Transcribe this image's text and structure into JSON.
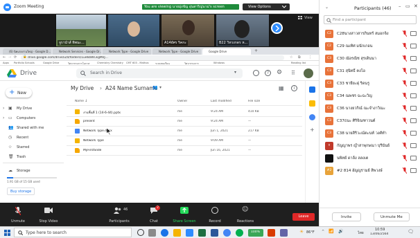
{
  "zoom": {
    "window_title": "Zoom Meeting",
    "view_label": "View",
    "banner_text": "You are viewing นายมุ่งขัญ อุ่นสาริญ่นาม่'s screen",
    "view_options_label": "View Options",
    "tiles": [
      {
        "label": "จูรานำส์ ทิพนะ..."
      },
      {
        "label": ""
      },
      {
        "label": "A14ยัศร ริคกะ"
      },
      {
        "label": "B22 วิทวงกดร ห..."
      }
    ],
    "toolbar": {
      "unmute": "Unmute",
      "stop_video": "Stop Video",
      "participants": "Participants",
      "participants_count": "46",
      "chat": "Chat",
      "chat_badge": "2",
      "share_screen": "Share Screen",
      "record": "Record",
      "reactions": "Reactions",
      "leave": "Leave"
    }
  },
  "browser": {
    "tabs": [
      "(6) นิคแรงงานใหญ่ - Google D...",
      "Network Services - Google Dr...",
      "Network Type - Google Drive",
      "Network Type - Google Drive",
      "Google Drive"
    ],
    "url": "drive.google.com/drive/u/0/folders/1ue6bWCkgMnJ...",
    "bookmarks": [
      "Apps",
      "Portfolio Schools",
      "Google Drive",
      "วิศวกรรมการโอกาส",
      "Chemistry Chemistry",
      "CMT 603 - Mathos",
      "ระบบทบเรียน",
      "วิศวกรรมการ",
      "Windows",
      "Reading list"
    ]
  },
  "drive": {
    "app_name": "Drive",
    "search_placeholder": "Search in Drive",
    "new_label": "New",
    "breadcrumb_root": "My Drive",
    "breadcrumb_folder": "A24 Name Surname",
    "columns": {
      "name": "Name",
      "owner": "Owner",
      "modified": "Last modified",
      "size": "File size"
    },
    "sidebar": [
      {
        "label": "My Drive"
      },
      {
        "label": "Computers"
      },
      {
        "label": "Shared with me"
      },
      {
        "label": "Recent"
      },
      {
        "label": "Starred"
      },
      {
        "label": "Trash"
      }
    ],
    "storage_label": "Storage",
    "storage_used": "1.91 GB of 15 GB used",
    "buy_storage": "Buy storage",
    "files": [
      {
        "name": "งานชิ้นที่ 1 (14-6-44).pptx",
        "owner": "me",
        "modified": "9:24 AM",
        "size": "410 KB",
        "type": "slides"
      },
      {
        "name": "present",
        "owner": "me",
        "modified": "9:24 AM",
        "size": "—",
        "type": "folder"
      },
      {
        "name": "Network Type.docx",
        "owner": "me",
        "modified": "Jun 1, 2021",
        "size": "217 KB",
        "type": "doc"
      },
      {
        "name": "Network Type",
        "owner": "me",
        "modified": "9:09 AM",
        "size": "—",
        "type": "slides"
      },
      {
        "name": "MyFirstSlide",
        "owner": "me",
        "modified": "Jun 16, 2021",
        "size": "—",
        "type": "folder"
      }
    ]
  },
  "participants": {
    "title": "Participants (46)",
    "search_placeholder": "Find a participant",
    "list": [
      {
        "initials": "C2",
        "name": "C28นางสาวสารภินทร์ สมอกจิ่ง",
        "color": "#e8733a"
      },
      {
        "initials": "C2",
        "name": "C29 ณเทิศ มนักเกอน",
        "color": "#e8733a"
      },
      {
        "initials": "C3",
        "name": "C30 ณัอรณิช สุรเดินนา",
        "color": "#e8733a"
      },
      {
        "initials": "C3",
        "name": "C31 สุนิทธิ์ คงโอ",
        "color": "#e8733a"
      },
      {
        "initials": "C3",
        "name": "C33 ชายียะฝุ ริดนรู",
        "color": "#e8733a"
      },
      {
        "initials": "C3",
        "name": "C34 ณพชร ฉะฉะวิญ",
        "color": "#e8733a"
      },
      {
        "initials": "C3",
        "name": "C36 นางยวกิณ์ ณะจำงาวิณะ",
        "color": "#e8733a"
      },
      {
        "initials": "C3",
        "name": "C37ธนะ ศิริจิณฑาวนต์",
        "color": "#e8733a"
      },
      {
        "initials": "C3",
        "name": "C38 นายสิริวะณ์ตะนท์ วงศ์ทำ",
        "color": "#e8733a"
      },
      {
        "initials": "ก",
        "name": "กัญญาพร ญ้ำสาพุกษณา บุรีนันย์",
        "color": "#c0392b"
      },
      {
        "initials": "",
        "name": "นพิทย์ ดาล้ัง ลลงเต",
        "color": "#111111"
      },
      {
        "initials": "#2",
        "name": "#2 814 อัญญรามย์ สิพวงษ์",
        "color": "#e8a33a"
      }
    ],
    "invite": "Invite",
    "unmute_me": "Unmute Me"
  },
  "taskbar": {
    "search_placeholder": "Type here to search",
    "weather": "86°F",
    "time": "10:59",
    "date": "13/06/2564",
    "language": "ไทย",
    "battery": "100%"
  },
  "colors": {
    "drive_blue": "#1a73e8",
    "zoom_blue": "#2d8cff",
    "leave_red": "#e02828",
    "share_green": "#23d959",
    "avatar_orange": "#e8733a"
  }
}
